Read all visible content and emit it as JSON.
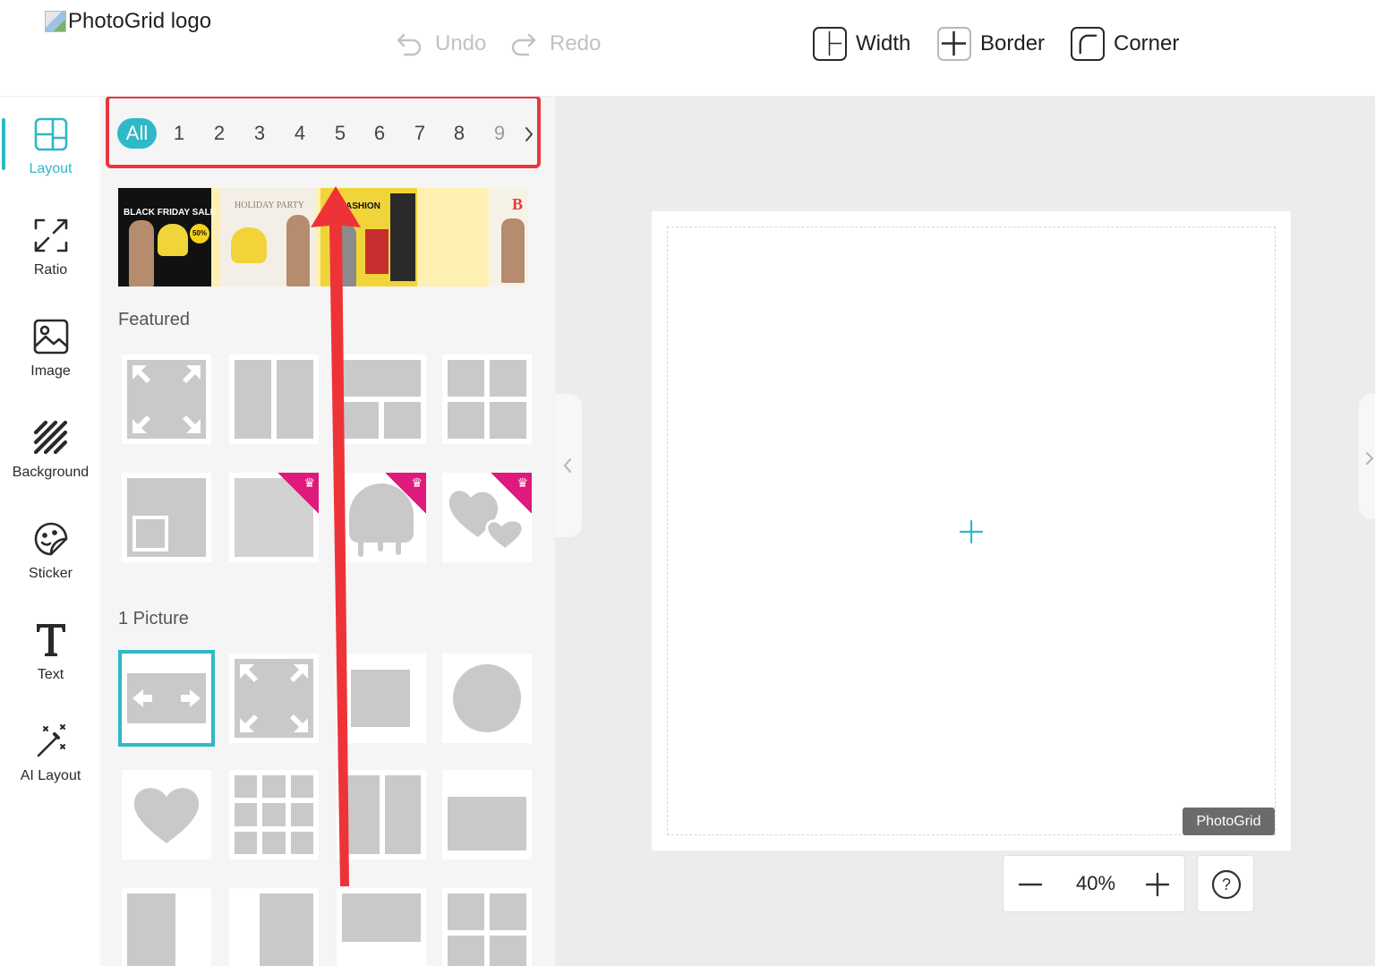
{
  "header": {
    "logo_alt": "PhotoGrid logo",
    "undo_label": "Undo",
    "redo_label": "Redo",
    "tools": [
      {
        "label": "Width",
        "icon": "width-icon"
      },
      {
        "label": "Border",
        "icon": "border-icon"
      },
      {
        "label": "Corner",
        "icon": "corner-icon"
      }
    ]
  },
  "sidebar": {
    "active": "Layout",
    "accent_color": "#2fb8c6",
    "items": [
      {
        "label": "Layout",
        "icon": "layout-icon"
      },
      {
        "label": "Ratio",
        "icon": "ratio-icon"
      },
      {
        "label": "Image",
        "icon": "image-icon"
      },
      {
        "label": "Background",
        "icon": "background-icon"
      },
      {
        "label": "Sticker",
        "icon": "sticker-icon"
      },
      {
        "label": "Text",
        "icon": "text-icon"
      },
      {
        "label": "AI Layout",
        "icon": "ai-layout-icon"
      }
    ]
  },
  "panel": {
    "filter_tabs": [
      "All",
      "1",
      "2",
      "3",
      "4",
      "5",
      "6",
      "7",
      "8",
      "9"
    ],
    "active_tab": "All",
    "banner": {
      "black_friday": "BLACK FRIDAY SALE",
      "black_friday_badge": "50%",
      "holiday": "HOLIDAY PARTY",
      "fashion": "ASHION"
    },
    "sections": [
      {
        "title": "Featured"
      },
      {
        "title": "1 Picture"
      }
    ],
    "premium_color": "#e0197c"
  },
  "canvas": {
    "watermark": "PhotoGrid",
    "zoom": "40%",
    "help_symbol": "?"
  },
  "annotation": {
    "highlight_color": "#e8383d"
  }
}
